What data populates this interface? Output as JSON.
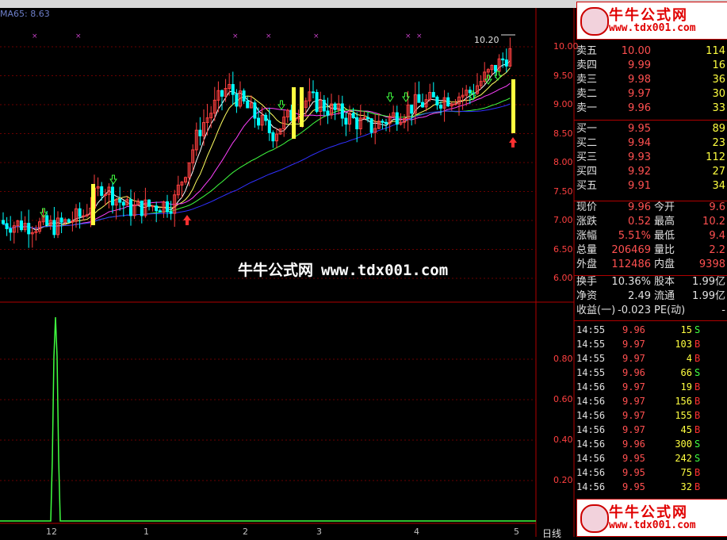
{
  "ma_label": "MA65: 8.63",
  "price_marker": "10.20",
  "watermark": {
    "brand": "牛牛公式网",
    "url": "www.tdx001.com"
  },
  "logo": {
    "brand": "牛牛公式网",
    "url": "www.tdx001.com"
  },
  "logo_bottom": {
    "brand": "牛牛公式网",
    "url": "www.tdx001.com"
  },
  "price_axis": [
    "10.00",
    "9.50",
    "9.00",
    "8.50",
    "8.00",
    "7.50",
    "7.00",
    "6.50",
    "6.00"
  ],
  "indicator_axis": [
    "0.80",
    "0.60",
    "0.40",
    "0.20"
  ],
  "x_axis": [
    "12",
    "1",
    "2",
    "3",
    "4",
    "5"
  ],
  "period_label": "日线",
  "order_book": [
    {
      "side": "卖五",
      "price": "10.00",
      "vol": "114"
    },
    {
      "side": "卖四",
      "price": "9.99",
      "vol": "16"
    },
    {
      "side": "卖三",
      "price": "9.98",
      "vol": "36"
    },
    {
      "side": "卖二",
      "price": "9.97",
      "vol": "30"
    },
    {
      "side": "卖一",
      "price": "9.96",
      "vol": "33"
    },
    {
      "side": "买一",
      "price": "9.95",
      "vol": "89"
    },
    {
      "side": "买二",
      "price": "9.94",
      "vol": "23"
    },
    {
      "side": "买三",
      "price": "9.93",
      "vol": "112"
    },
    {
      "side": "买四",
      "price": "9.92",
      "vol": "27"
    },
    {
      "side": "买五",
      "price": "9.91",
      "vol": "34"
    }
  ],
  "quote": [
    {
      "k1": "现价",
      "v1": "9.96",
      "k2": "今开",
      "v2": "9.6"
    },
    {
      "k1": "涨跌",
      "v1": "0.52",
      "k2": "最高",
      "v2": "10.2"
    },
    {
      "k1": "涨幅",
      "v1": "5.51%",
      "k2": "最低",
      "v2": "9.4"
    },
    {
      "k1": "总量",
      "v1": "206469",
      "k2": "量比",
      "v2": "2.2"
    },
    {
      "k1": "外盘",
      "v1": "112486",
      "k2": "内盘",
      "v2": "9398"
    }
  ],
  "fundamentals": [
    {
      "k1": "换手",
      "v1": "10.36%",
      "k2": "股本",
      "v2": "1.99亿"
    },
    {
      "k1": "净资",
      "v1": "2.49",
      "k2": "流通",
      "v2": "1.99亿"
    },
    {
      "k1": "收益(一)",
      "v1": "-0.023",
      "k2": "PE(动)",
      "v2": "-"
    }
  ],
  "trades": [
    {
      "time": "14:55",
      "price": "9.96",
      "vol": "15",
      "side": "S"
    },
    {
      "time": "14:55",
      "price": "9.97",
      "vol": "103",
      "side": "B"
    },
    {
      "time": "14:55",
      "price": "9.97",
      "vol": "4",
      "side": "B"
    },
    {
      "time": "14:55",
      "price": "9.96",
      "vol": "66",
      "side": "S"
    },
    {
      "time": "14:56",
      "price": "9.97",
      "vol": "19",
      "side": "B"
    },
    {
      "time": "14:56",
      "price": "9.97",
      "vol": "156",
      "side": "B"
    },
    {
      "time": "14:56",
      "price": "9.97",
      "vol": "155",
      "side": "B"
    },
    {
      "time": "14:56",
      "price": "9.97",
      "vol": "45",
      "side": "B"
    },
    {
      "time": "14:56",
      "price": "9.96",
      "vol": "300",
      "side": "S"
    },
    {
      "time": "14:56",
      "price": "9.95",
      "vol": "242",
      "side": "S"
    },
    {
      "time": "14:56",
      "price": "9.95",
      "vol": "75",
      "side": "B"
    },
    {
      "time": "14:56",
      "price": "9.95",
      "vol": "32",
      "side": "B"
    }
  ],
  "colors": {
    "up": "#ff4040",
    "down": "#00ffff",
    "grid": "#6a0000",
    "buy": "#ff3030",
    "sell": "#40ff40",
    "signal": "#ffff40"
  }
}
